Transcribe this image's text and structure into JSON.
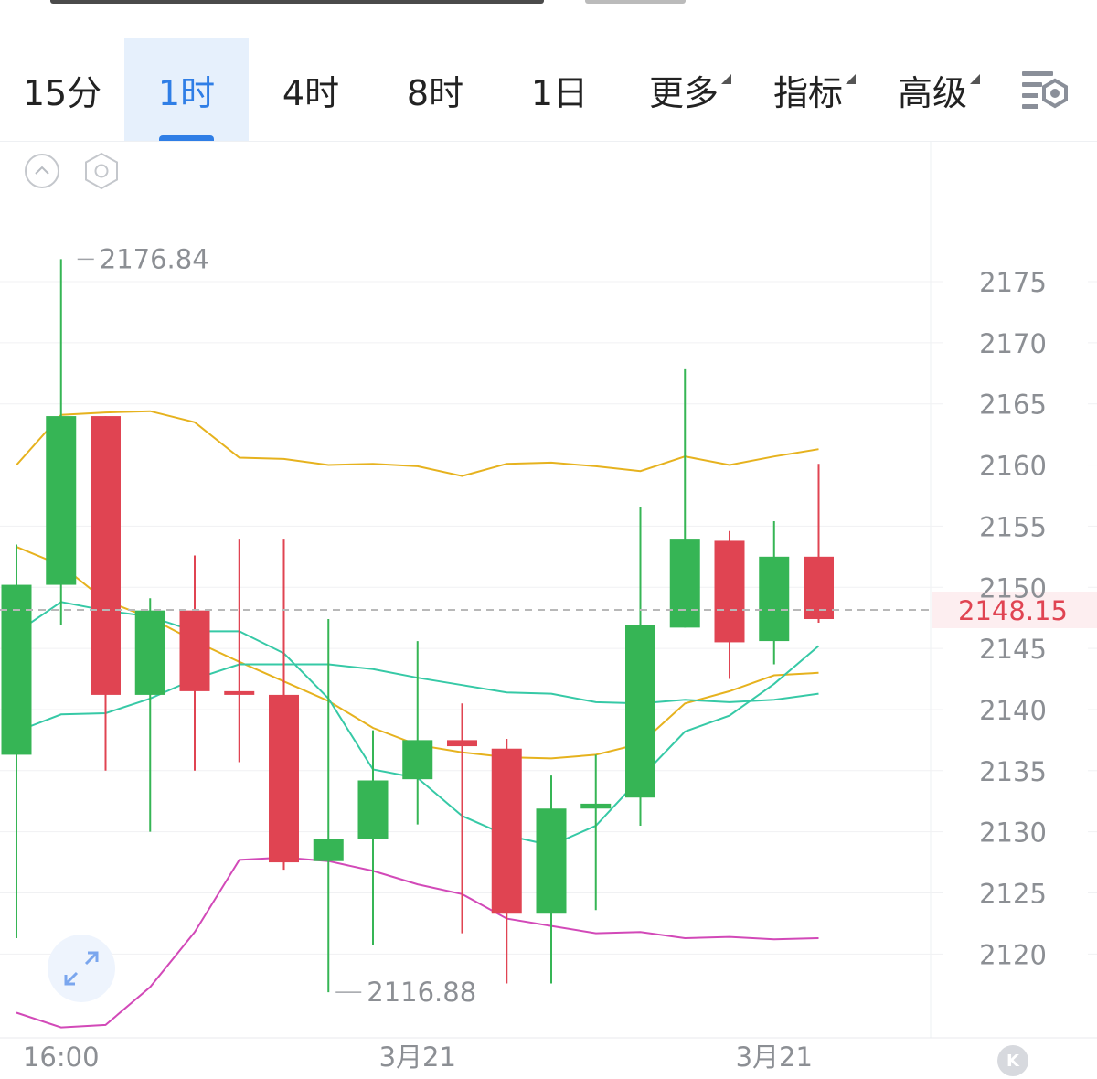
{
  "tabs": [
    {
      "label": "15分",
      "active": false
    },
    {
      "label": "1时",
      "active": true
    },
    {
      "label": "4时",
      "active": false
    },
    {
      "label": "8时",
      "active": false
    },
    {
      "label": "1日",
      "active": false
    },
    {
      "label": "更多",
      "active": false,
      "dropdown": true
    },
    {
      "label": "指标",
      "active": false,
      "dropdown": true
    },
    {
      "label": "高级",
      "active": false,
      "dropdown": true
    }
  ],
  "icons": {
    "settings": "list-settings-icon",
    "collapse": "chevron-up-circle-icon",
    "hexagon": "hexagon-settings-icon",
    "expand": "expand-arrows-icon",
    "k": "k-back-icon"
  },
  "colors": {
    "up": "#36b555",
    "down": "#e04452",
    "accent": "#2f7ee6",
    "boll_upper": "#e6b21e",
    "boll_mid": "#e6b21e",
    "ma_teal": "#36c9a6",
    "boll_lower": "#d249b8",
    "price_line": "#e04452"
  },
  "chart_data": {
    "type": "candlestick",
    "ylim": [
      2111,
      2180
    ],
    "yticks": [
      2175,
      2170,
      2165,
      2160,
      2155,
      2150,
      2145,
      2140,
      2135,
      2130,
      2125,
      2120
    ],
    "y_tick_labels": [
      "2175",
      "2170",
      "2165",
      "2160",
      "2155",
      "2150",
      "2145",
      "2140",
      "2135",
      "2130",
      "2125",
      "2120"
    ],
    "x_tick_labels": [
      "16:00",
      "3月21",
      "3月21"
    ],
    "x_tick_indices": [
      1,
      9,
      17
    ],
    "last_price": 2148.15,
    "last_price_label": "2148.15",
    "high_label": "2176.84",
    "low_label": "2116.88",
    "high_index": 1,
    "low_index": 7,
    "candles": [
      {
        "open": 2136.3,
        "close": 2150.2,
        "high": 2153.5,
        "low": 2121.3
      },
      {
        "open": 2150.2,
        "close": 2164.0,
        "high": 2176.84,
        "low": 2146.9
      },
      {
        "open": 2164.0,
        "close": 2141.2,
        "high": 2164.0,
        "low": 2135.0
      },
      {
        "open": 2141.2,
        "close": 2148.1,
        "high": 2149.1,
        "low": 2130.0
      },
      {
        "open": 2148.1,
        "close": 2141.5,
        "high": 2152.6,
        "low": 2135.0
      },
      {
        "open": 2141.5,
        "close": 2141.2,
        "high": 2153.9,
        "low": 2135.7
      },
      {
        "open": 2141.2,
        "close": 2127.5,
        "high": 2153.9,
        "low": 2126.9
      },
      {
        "open": 2127.6,
        "close": 2129.4,
        "high": 2147.4,
        "low": 2116.88
      },
      {
        "open": 2129.4,
        "close": 2134.2,
        "high": 2138.3,
        "low": 2120.7
      },
      {
        "open": 2134.3,
        "close": 2137.5,
        "high": 2145.6,
        "low": 2130.6
      },
      {
        "open": 2137.5,
        "close": 2137.0,
        "high": 2140.5,
        "low": 2121.7
      },
      {
        "open": 2136.8,
        "close": 2123.3,
        "high": 2137.6,
        "low": 2117.6
      },
      {
        "open": 2123.3,
        "close": 2131.9,
        "high": 2134.6,
        "low": 2117.6
      },
      {
        "open": 2131.9,
        "close": 2132.3,
        "high": 2136.3,
        "low": 2123.6
      },
      {
        "open": 2132.8,
        "close": 2146.9,
        "high": 2156.6,
        "low": 2130.5
      },
      {
        "open": 2146.7,
        "close": 2153.9,
        "high": 2167.9,
        "low": 2146.7
      },
      {
        "open": 2153.8,
        "close": 2145.5,
        "high": 2154.6,
        "low": 2142.5
      },
      {
        "open": 2145.6,
        "close": 2152.5,
        "high": 2155.4,
        "low": 2143.7
      },
      {
        "open": 2152.5,
        "close": 2147.4,
        "high": 2160.1,
        "low": 2147.1
      }
    ],
    "lines": [
      {
        "key": "boll_upper",
        "color": "#e6b21e",
        "values": [
          2160.0,
          2164.1,
          2164.3,
          2164.4,
          2163.5,
          2160.6,
          2160.5,
          2160.0,
          2160.1,
          2159.9,
          2159.1,
          2160.1,
          2160.2,
          2159.9,
          2159.5,
          2160.7,
          2160.0,
          2160.7,
          2161.3
        ]
      },
      {
        "key": "boll_mid",
        "color": "#e6b21e",
        "values": [
          2153.3,
          2151.8,
          2148.9,
          2147.5,
          2145.6,
          2143.9,
          2142.3,
          2140.7,
          2138.5,
          2137.1,
          2136.5,
          2136.1,
          2136.0,
          2136.3,
          2137.2,
          2140.5,
          2141.5,
          2142.8,
          2143.0
        ]
      },
      {
        "key": "ma_teal_1",
        "color": "#36c9a6",
        "values": [
          2146.3,
          2148.8,
          2148.1,
          2147.6,
          2146.4,
          2146.4,
          2144.6,
          2140.9,
          2135.1,
          2134.4,
          2131.3,
          2129.7,
          2128.9,
          2130.5,
          2134.4,
          2138.2,
          2139.5,
          2142.1,
          2145.2
        ]
      },
      {
        "key": "ma_teal_2",
        "color": "#36c9a6",
        "values": [
          2138.2,
          2139.6,
          2139.7,
          2140.9,
          2142.5,
          2143.7,
          2143.7,
          2143.7,
          2143.3,
          2142.6,
          2142.0,
          2141.4,
          2141.3,
          2140.6,
          2140.5,
          2140.8,
          2140.6,
          2140.8,
          2141.3
        ]
      },
      {
        "key": "boll_lower",
        "color": "#d249b8",
        "values": [
          2115.2,
          2114.0,
          2114.2,
          2117.3,
          2121.8,
          2127.7,
          2127.9,
          2127.6,
          2126.8,
          2125.7,
          2124.9,
          2122.9,
          2122.3,
          2121.7,
          2121.8,
          2121.3,
          2121.4,
          2121.2,
          2121.3
        ]
      }
    ]
  }
}
